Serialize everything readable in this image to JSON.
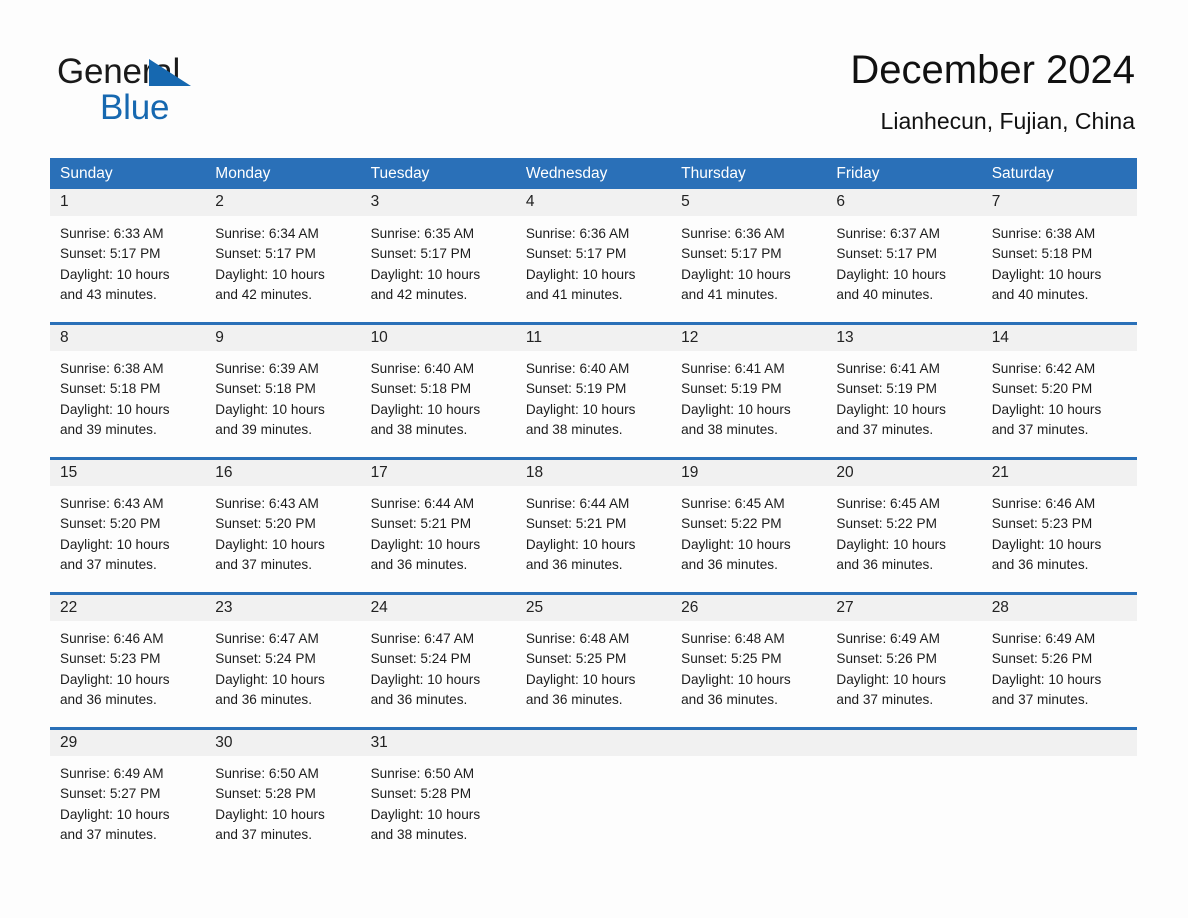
{
  "brand": {
    "name_part1": "General",
    "name_part2": "Blue",
    "triangle_color": "#1668b0",
    "text_color": "#1a1a1a"
  },
  "header": {
    "title": "December 2024",
    "location": "Lianhecun, Fujian, China"
  },
  "theme": {
    "header_bar_color": "#2a70b8",
    "day_strip_color": "#f1f1f1",
    "rule_color": "#2a70b8",
    "page_background": "#fdfdfd"
  },
  "weekday_headers": [
    "Sunday",
    "Monday",
    "Tuesday",
    "Wednesday",
    "Thursday",
    "Friday",
    "Saturday"
  ],
  "weeks": [
    {
      "days": [
        {
          "num": "1",
          "sunrise": "Sunrise: 6:33 AM",
          "sunset": "Sunset: 5:17 PM",
          "daylight1": "Daylight: 10 hours",
          "daylight2": "and 43 minutes."
        },
        {
          "num": "2",
          "sunrise": "Sunrise: 6:34 AM",
          "sunset": "Sunset: 5:17 PM",
          "daylight1": "Daylight: 10 hours",
          "daylight2": "and 42 minutes."
        },
        {
          "num": "3",
          "sunrise": "Sunrise: 6:35 AM",
          "sunset": "Sunset: 5:17 PM",
          "daylight1": "Daylight: 10 hours",
          "daylight2": "and 42 minutes."
        },
        {
          "num": "4",
          "sunrise": "Sunrise: 6:36 AM",
          "sunset": "Sunset: 5:17 PM",
          "daylight1": "Daylight: 10 hours",
          "daylight2": "and 41 minutes."
        },
        {
          "num": "5",
          "sunrise": "Sunrise: 6:36 AM",
          "sunset": "Sunset: 5:17 PM",
          "daylight1": "Daylight: 10 hours",
          "daylight2": "and 41 minutes."
        },
        {
          "num": "6",
          "sunrise": "Sunrise: 6:37 AM",
          "sunset": "Sunset: 5:17 PM",
          "daylight1": "Daylight: 10 hours",
          "daylight2": "and 40 minutes."
        },
        {
          "num": "7",
          "sunrise": "Sunrise: 6:38 AM",
          "sunset": "Sunset: 5:18 PM",
          "daylight1": "Daylight: 10 hours",
          "daylight2": "and 40 minutes."
        }
      ]
    },
    {
      "days": [
        {
          "num": "8",
          "sunrise": "Sunrise: 6:38 AM",
          "sunset": "Sunset: 5:18 PM",
          "daylight1": "Daylight: 10 hours",
          "daylight2": "and 39 minutes."
        },
        {
          "num": "9",
          "sunrise": "Sunrise: 6:39 AM",
          "sunset": "Sunset: 5:18 PM",
          "daylight1": "Daylight: 10 hours",
          "daylight2": "and 39 minutes."
        },
        {
          "num": "10",
          "sunrise": "Sunrise: 6:40 AM",
          "sunset": "Sunset: 5:18 PM",
          "daylight1": "Daylight: 10 hours",
          "daylight2": "and 38 minutes."
        },
        {
          "num": "11",
          "sunrise": "Sunrise: 6:40 AM",
          "sunset": "Sunset: 5:19 PM",
          "daylight1": "Daylight: 10 hours",
          "daylight2": "and 38 minutes."
        },
        {
          "num": "12",
          "sunrise": "Sunrise: 6:41 AM",
          "sunset": "Sunset: 5:19 PM",
          "daylight1": "Daylight: 10 hours",
          "daylight2": "and 38 minutes."
        },
        {
          "num": "13",
          "sunrise": "Sunrise: 6:41 AM",
          "sunset": "Sunset: 5:19 PM",
          "daylight1": "Daylight: 10 hours",
          "daylight2": "and 37 minutes."
        },
        {
          "num": "14",
          "sunrise": "Sunrise: 6:42 AM",
          "sunset": "Sunset: 5:20 PM",
          "daylight1": "Daylight: 10 hours",
          "daylight2": "and 37 minutes."
        }
      ]
    },
    {
      "days": [
        {
          "num": "15",
          "sunrise": "Sunrise: 6:43 AM",
          "sunset": "Sunset: 5:20 PM",
          "daylight1": "Daylight: 10 hours",
          "daylight2": "and 37 minutes."
        },
        {
          "num": "16",
          "sunrise": "Sunrise: 6:43 AM",
          "sunset": "Sunset: 5:20 PM",
          "daylight1": "Daylight: 10 hours",
          "daylight2": "and 37 minutes."
        },
        {
          "num": "17",
          "sunrise": "Sunrise: 6:44 AM",
          "sunset": "Sunset: 5:21 PM",
          "daylight1": "Daylight: 10 hours",
          "daylight2": "and 36 minutes."
        },
        {
          "num": "18",
          "sunrise": "Sunrise: 6:44 AM",
          "sunset": "Sunset: 5:21 PM",
          "daylight1": "Daylight: 10 hours",
          "daylight2": "and 36 minutes."
        },
        {
          "num": "19",
          "sunrise": "Sunrise: 6:45 AM",
          "sunset": "Sunset: 5:22 PM",
          "daylight1": "Daylight: 10 hours",
          "daylight2": "and 36 minutes."
        },
        {
          "num": "20",
          "sunrise": "Sunrise: 6:45 AM",
          "sunset": "Sunset: 5:22 PM",
          "daylight1": "Daylight: 10 hours",
          "daylight2": "and 36 minutes."
        },
        {
          "num": "21",
          "sunrise": "Sunrise: 6:46 AM",
          "sunset": "Sunset: 5:23 PM",
          "daylight1": "Daylight: 10 hours",
          "daylight2": "and 36 minutes."
        }
      ]
    },
    {
      "days": [
        {
          "num": "22",
          "sunrise": "Sunrise: 6:46 AM",
          "sunset": "Sunset: 5:23 PM",
          "daylight1": "Daylight: 10 hours",
          "daylight2": "and 36 minutes."
        },
        {
          "num": "23",
          "sunrise": "Sunrise: 6:47 AM",
          "sunset": "Sunset: 5:24 PM",
          "daylight1": "Daylight: 10 hours",
          "daylight2": "and 36 minutes."
        },
        {
          "num": "24",
          "sunrise": "Sunrise: 6:47 AM",
          "sunset": "Sunset: 5:24 PM",
          "daylight1": "Daylight: 10 hours",
          "daylight2": "and 36 minutes."
        },
        {
          "num": "25",
          "sunrise": "Sunrise: 6:48 AM",
          "sunset": "Sunset: 5:25 PM",
          "daylight1": "Daylight: 10 hours",
          "daylight2": "and 36 minutes."
        },
        {
          "num": "26",
          "sunrise": "Sunrise: 6:48 AM",
          "sunset": "Sunset: 5:25 PM",
          "daylight1": "Daylight: 10 hours",
          "daylight2": "and 36 minutes."
        },
        {
          "num": "27",
          "sunrise": "Sunrise: 6:49 AM",
          "sunset": "Sunset: 5:26 PM",
          "daylight1": "Daylight: 10 hours",
          "daylight2": "and 37 minutes."
        },
        {
          "num": "28",
          "sunrise": "Sunrise: 6:49 AM",
          "sunset": "Sunset: 5:26 PM",
          "daylight1": "Daylight: 10 hours",
          "daylight2": "and 37 minutes."
        }
      ]
    },
    {
      "days": [
        {
          "num": "29",
          "sunrise": "Sunrise: 6:49 AM",
          "sunset": "Sunset: 5:27 PM",
          "daylight1": "Daylight: 10 hours",
          "daylight2": "and 37 minutes."
        },
        {
          "num": "30",
          "sunrise": "Sunrise: 6:50 AM",
          "sunset": "Sunset: 5:28 PM",
          "daylight1": "Daylight: 10 hours",
          "daylight2": "and 37 minutes."
        },
        {
          "num": "31",
          "sunrise": "Sunrise: 6:50 AM",
          "sunset": "Sunset: 5:28 PM",
          "daylight1": "Daylight: 10 hours",
          "daylight2": "and 38 minutes."
        },
        {
          "num": "",
          "sunrise": "",
          "sunset": "",
          "daylight1": "",
          "daylight2": ""
        },
        {
          "num": "",
          "sunrise": "",
          "sunset": "",
          "daylight1": "",
          "daylight2": ""
        },
        {
          "num": "",
          "sunrise": "",
          "sunset": "",
          "daylight1": "",
          "daylight2": ""
        },
        {
          "num": "",
          "sunrise": "",
          "sunset": "",
          "daylight1": "",
          "daylight2": ""
        }
      ]
    }
  ]
}
